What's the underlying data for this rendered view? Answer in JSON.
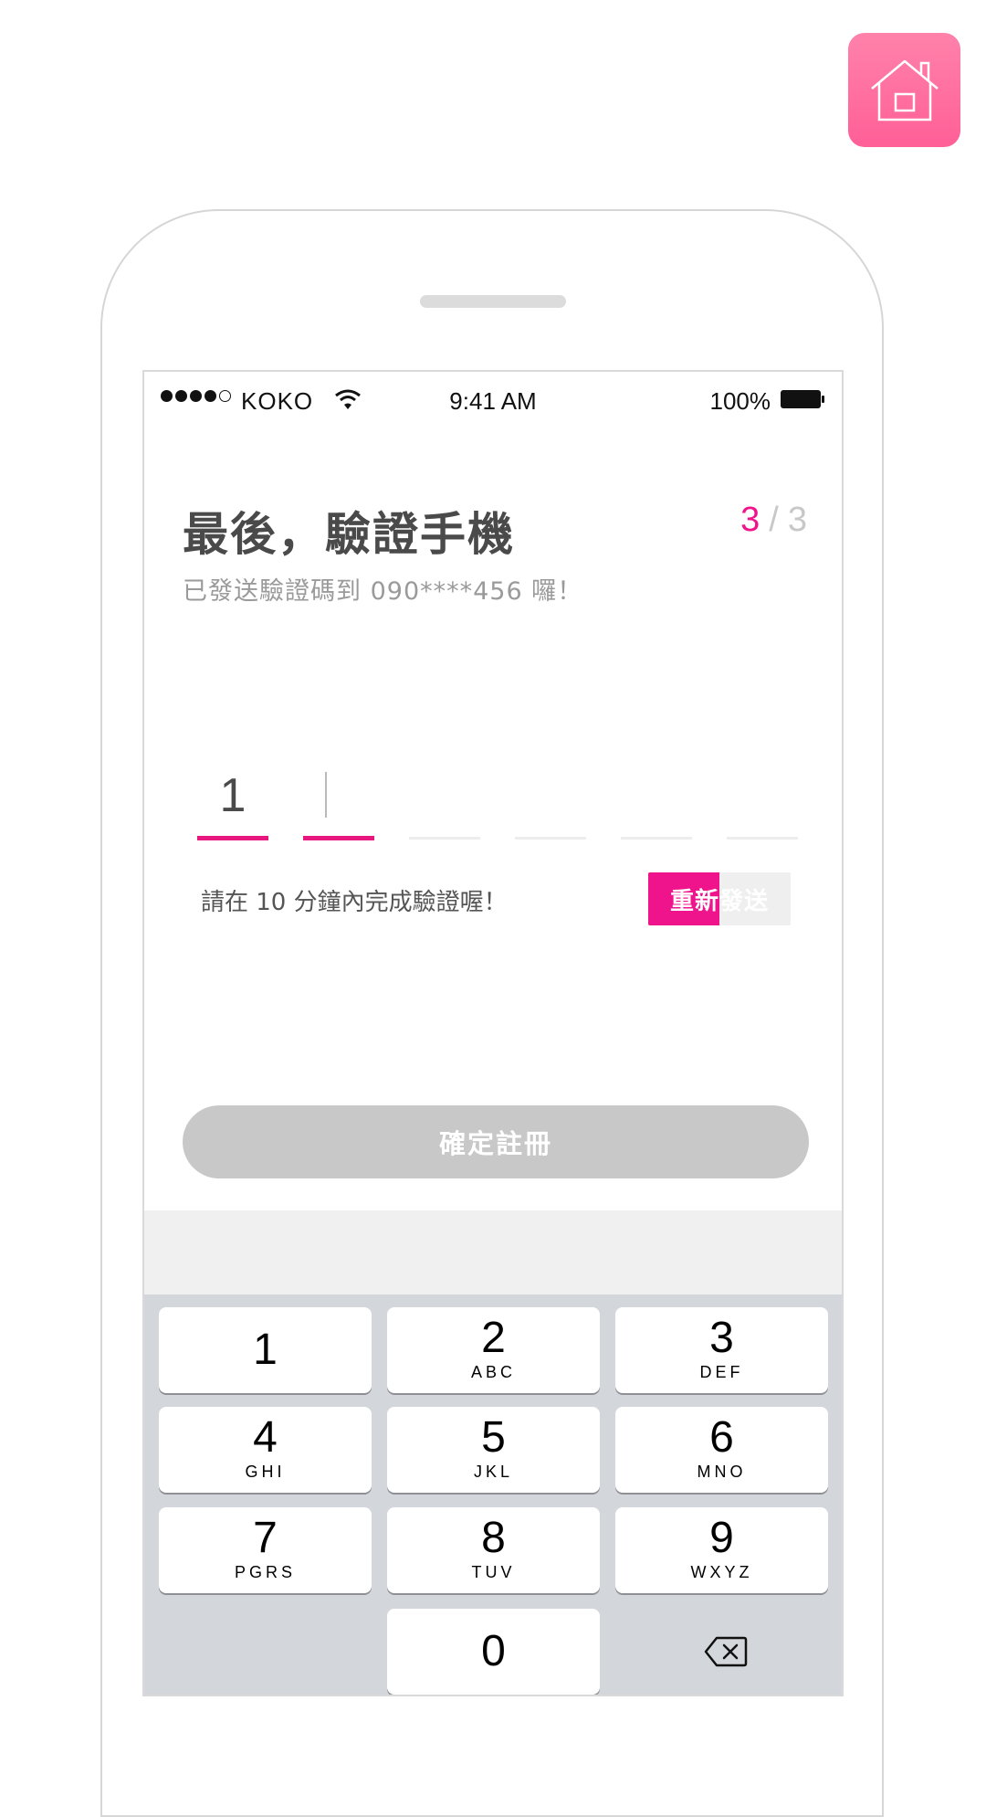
{
  "status_bar": {
    "carrier": "KOKO",
    "time": "9:41 AM",
    "battery": "100%"
  },
  "page": {
    "title": "最後，驗證手機",
    "step_current": "3",
    "step_separator": "/",
    "step_total": "3",
    "subtitle": "已發送驗證碼到 090****456 囉！"
  },
  "code": {
    "digits": [
      "1",
      "",
      "",
      "",
      "",
      ""
    ]
  },
  "hint": "請在 10 分鐘內完成驗證喔！",
  "resend_label": "重新發送",
  "confirm_label": "確定註冊",
  "keypad": {
    "keys": [
      {
        "num": "1",
        "letters": ""
      },
      {
        "num": "2",
        "letters": "ABC"
      },
      {
        "num": "3",
        "letters": "DEF"
      },
      {
        "num": "4",
        "letters": "GHI"
      },
      {
        "num": "5",
        "letters": "JKL"
      },
      {
        "num": "6",
        "letters": "MNO"
      },
      {
        "num": "7",
        "letters": "PGRS"
      },
      {
        "num": "8",
        "letters": "TUV"
      },
      {
        "num": "9",
        "letters": "WXYZ"
      },
      {
        "num": "0",
        "letters": ""
      }
    ]
  },
  "colors": {
    "accent": "#f0148c",
    "home_button": "#ff6f9f",
    "disabled_button": "#c8c8c8"
  },
  "icons": {
    "home": "home-icon",
    "delete": "backspace-icon"
  }
}
